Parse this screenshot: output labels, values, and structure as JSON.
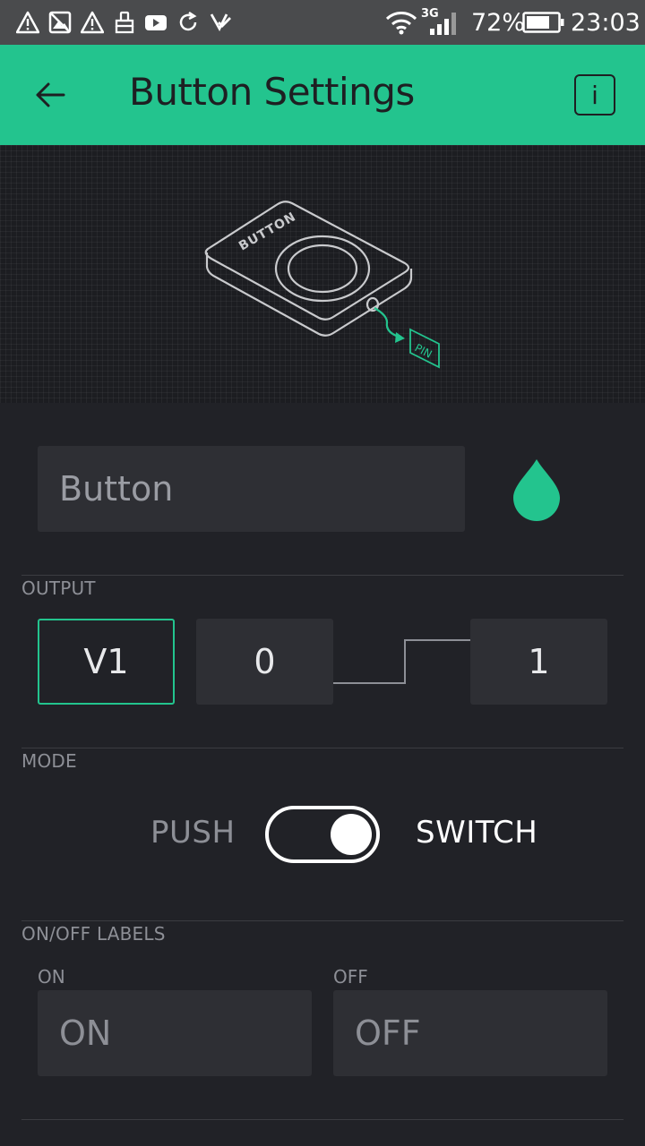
{
  "status_bar": {
    "left_icons": [
      "warning-icon",
      "image-off-icon",
      "warning-icon",
      "brush-icon",
      "youtube-icon",
      "sync-icon",
      "download-check-icon"
    ],
    "network": "3G",
    "battery": "72%",
    "time": "23:03"
  },
  "app_bar": {
    "back_icon": "arrow-back-icon",
    "title": "Button Settings",
    "info_label": "i"
  },
  "illustration": {
    "device_label": "BUTTON",
    "pin_label": "PIN"
  },
  "widget": {
    "name_placeholder": "Button",
    "color": "#23c48e"
  },
  "output": {
    "section_label": "OUTPUT",
    "pin": "V1",
    "low": "0",
    "high": "1"
  },
  "mode": {
    "section_label": "MODE",
    "left_option": "PUSH",
    "right_option": "SWITCH",
    "selected": "SWITCH"
  },
  "labels": {
    "section_label": "ON/OFF LABELS",
    "on_label": "ON",
    "on_placeholder": "ON",
    "off_label": "OFF",
    "off_placeholder": "OFF"
  },
  "colors": {
    "accent": "#23c48e",
    "background": "#212227",
    "field": "#2e2f34"
  }
}
